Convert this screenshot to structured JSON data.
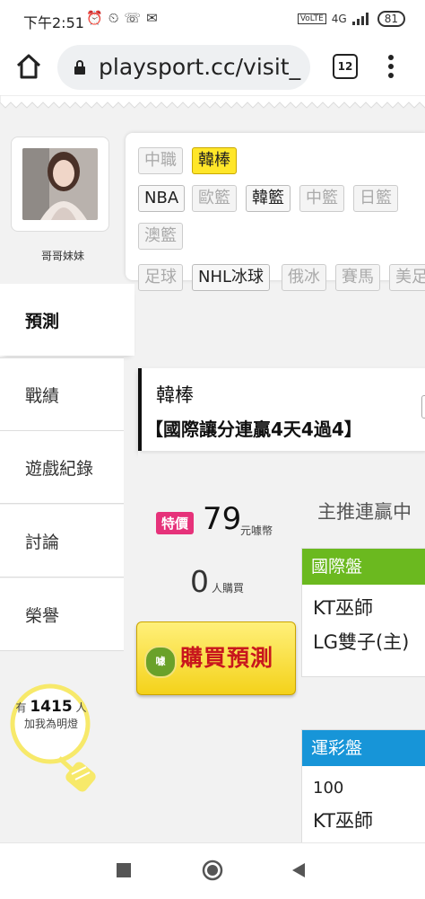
{
  "status": {
    "time": "下午2:51",
    "icons": [
      "alarm-icon",
      "alarm-clock-icon",
      "missed-call-icon",
      "gmail-icon"
    ],
    "network": "4G",
    "battery": "81"
  },
  "browser": {
    "url": "playsport.cc/visit_",
    "tab_count": "12"
  },
  "profile": {
    "username": "哥哥妹妹"
  },
  "categories": {
    "row1": [
      {
        "label": "中職",
        "state": "disabled"
      },
      {
        "label": "韓棒",
        "state": "selected"
      }
    ],
    "row2": [
      {
        "label": "NBA",
        "state": "enabled"
      },
      {
        "label": "歐籃",
        "state": "disabled"
      },
      {
        "label": "韓籃",
        "state": "enabled"
      },
      {
        "label": "中籃",
        "state": "disabled"
      },
      {
        "label": "日籃",
        "state": "disabled"
      }
    ],
    "row3": [
      {
        "label": "澳籃",
        "state": "disabled"
      }
    ],
    "row4": [
      {
        "label": "足球",
        "state": "disabled"
      },
      {
        "label": "NHL冰球",
        "state": "enabled"
      },
      {
        "label": "俄冰",
        "state": "disabled"
      },
      {
        "label": "賽馬",
        "state": "disabled"
      },
      {
        "label": "美足",
        "state": "disabled"
      }
    ]
  },
  "nav": {
    "items": [
      {
        "label": "預測",
        "active": true
      },
      {
        "label": "戰績",
        "active": false
      },
      {
        "label": "遊戲紀錄",
        "active": false
      },
      {
        "label": "討論",
        "active": false
      },
      {
        "label": "榮譽",
        "active": false
      }
    ]
  },
  "fans": {
    "prefix": "有",
    "count": "1415",
    "suffix": "人",
    "caption": "加我為明燈"
  },
  "prediction": {
    "league": "韓棒",
    "slogan": "【國際讓分連贏4天4過4】",
    "special_label": "特價",
    "price": "79",
    "price_unit": "元噱幣",
    "buyers": "0",
    "buyers_unit": "人購買",
    "buy_button": "購買預測",
    "medal_text": "噱",
    "streak_text": "主推連贏中",
    "intl": {
      "header": "國際盤",
      "color": "#6bb91f",
      "rows": [
        "KT巫師",
        "LG雙子(主)"
      ]
    },
    "lottery": {
      "header": "運彩盤",
      "color": "#1795d8",
      "rows": [
        "100",
        "KT巫師"
      ]
    }
  }
}
